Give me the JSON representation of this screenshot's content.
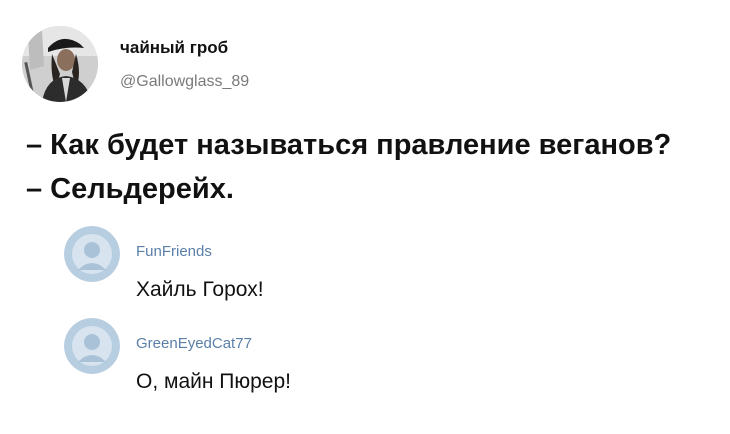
{
  "author": {
    "name": "чайный гроб",
    "handle": "@Gallowglass_89",
    "avatar_icon": "pirate-portrait-avatar"
  },
  "tweet": {
    "line1": "– Как будет называться правление веганов?",
    "line2": "– Сельдерейх."
  },
  "comments": [
    {
      "author": "FunFriends",
      "text": "Хайль Горох!",
      "avatar_icon": "default-avatar-icon"
    },
    {
      "author": "GreenEyedCat77",
      "text": "О, майн Пюрер!",
      "avatar_icon": "default-avatar-icon"
    }
  ],
  "colors": {
    "text": "#111111",
    "handle": "#7a7a7a",
    "comment_author": "#5a7fa8",
    "default_avatar": "#9fbfd9"
  }
}
